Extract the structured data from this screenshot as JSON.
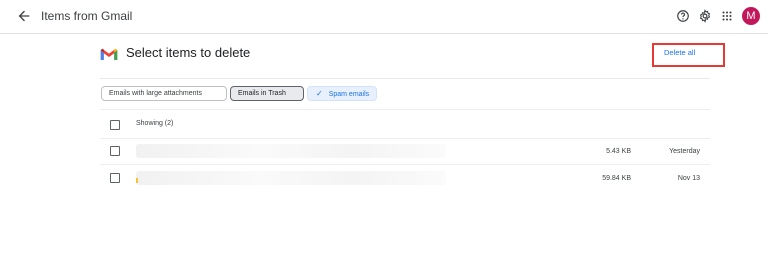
{
  "header": {
    "title": "Items from Gmail",
    "avatar_letter": "M"
  },
  "heading": "Select items to delete",
  "delete_all_label": "Delete all",
  "filters": [
    {
      "label": "Emails with large attachments",
      "selected": false
    },
    {
      "label": "Emails in Trash",
      "selected": false
    },
    {
      "label": "Spam emails",
      "selected": true
    }
  ],
  "showing_label": "Showing (2)",
  "rows": [
    {
      "size": "5.43 KB",
      "date": "Yesterday"
    },
    {
      "size": "59.84 KB",
      "date": "Nov 13"
    }
  ],
  "colors": {
    "accent": "#1a73e8",
    "highlight_box": "#e53935",
    "avatar": "#c2185b"
  }
}
